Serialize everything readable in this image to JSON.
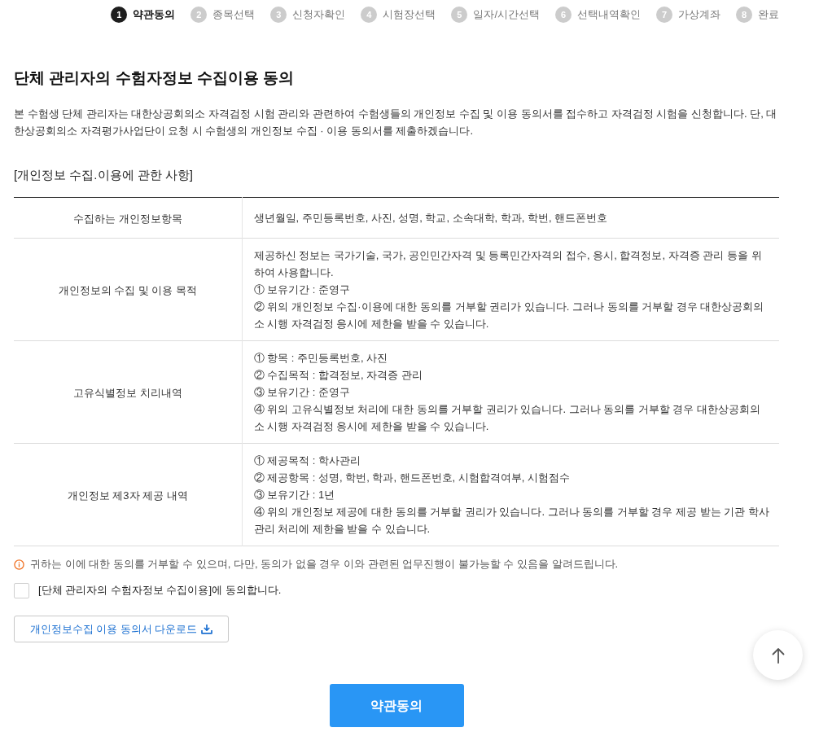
{
  "steps": [
    {
      "number": "1",
      "label": "약관동의",
      "selected": true
    },
    {
      "number": "2",
      "label": "종목선택",
      "selected": false
    },
    {
      "number": "3",
      "label": "신청자확인",
      "selected": false
    },
    {
      "number": "4",
      "label": "시험장선택",
      "selected": false
    },
    {
      "number": "5",
      "label": "일자/시간선택",
      "selected": false
    },
    {
      "number": "6",
      "label": "선택내역확인",
      "selected": false
    },
    {
      "number": "7",
      "label": "가상계좌",
      "selected": false
    },
    {
      "number": "8",
      "label": "완료",
      "selected": false
    }
  ],
  "title": "단체 관리자의 수험자정보 수집이용 동의",
  "intro": "본 수험생 단체 관리자는 대한상공회의소 자격검정 시험 관리와 관련하여 수험생들의 개인정보 수집 및 이용 동의서를 접수하고 자격검정 시험을 신청합니다. 단, 대한상공회의소 자격평가사업단이 요청 시 수험생의 개인정보 수집 · 이용 동의서를 제출하겠습니다.",
  "section_heading": "[개인정보 수집.이용에 관한 사항]",
  "table": {
    "rows": [
      {
        "label": "수집하는 개인정보항목",
        "lines": [
          "생년월일, 주민등록번호, 사진, 성명, 학교, 소속대학, 학과, 학번, 핸드폰번호"
        ]
      },
      {
        "label": "개인정보의 수집 및 이용 목적",
        "lines": [
          "제공하신 정보는 국가기술, 국가, 공인민간자격 및 등록민간자격의 접수, 응시, 합격정보, 자격증 관리 등을 위하여 사용합니다.",
          "① 보유기간 : 준영구",
          "② 위의 개인정보 수집·이용에 대한 동의를 거부할 권리가 있습니다. 그러나 동의를 거부할 경우 대한상공회의소 시행 자격검정 응시에 제한을 받을 수 있습니다."
        ]
      },
      {
        "label": "고유식별정보 치리내역",
        "lines": [
          "① 항목 : 주민등록번호, 사진",
          "② 수집목적 : 합격정보, 자격증 관리",
          "③ 보유기간 : 준영구",
          "④ 위의 고유식별정보 처리에 대한 동의를 거부할 권리가 있습니다. 그러나 동의를 거부할 경우 대한상공회의소 시행 자격검정 응시에 제한을 받을 수 있습니다."
        ]
      },
      {
        "label": "개인정보 제3자 제공 내역",
        "lines": [
          "① 제공목적 : 학사관리",
          "② 제공항목 : 성명, 학번, 학과, 핸드폰번호, 시험합격여부, 시험점수",
          "③ 보유기간 : 1년",
          "④ 위의 개인정보 제공에 대한 동의를 거부할 권리가 있습니다. 그러나 동의를 거부할 경우 제공 받는 기관 학사관리 처리에 제한을 받을 수 있습니다."
        ]
      }
    ]
  },
  "notice": "귀하는 이에 대한 동의를 거부할 수 있으며, 다만, 동의가 없을 경우 이와 관련된 업무진행이 불가능할 수 있음을 알려드립니다.",
  "consent": {
    "label": "[단체 관리자의 수험자정보 수집이용]에 동의합니다.",
    "checked": false
  },
  "download_button": "개인정보수집 이용 동의서 다운로드",
  "submit_button": "약관동의"
}
